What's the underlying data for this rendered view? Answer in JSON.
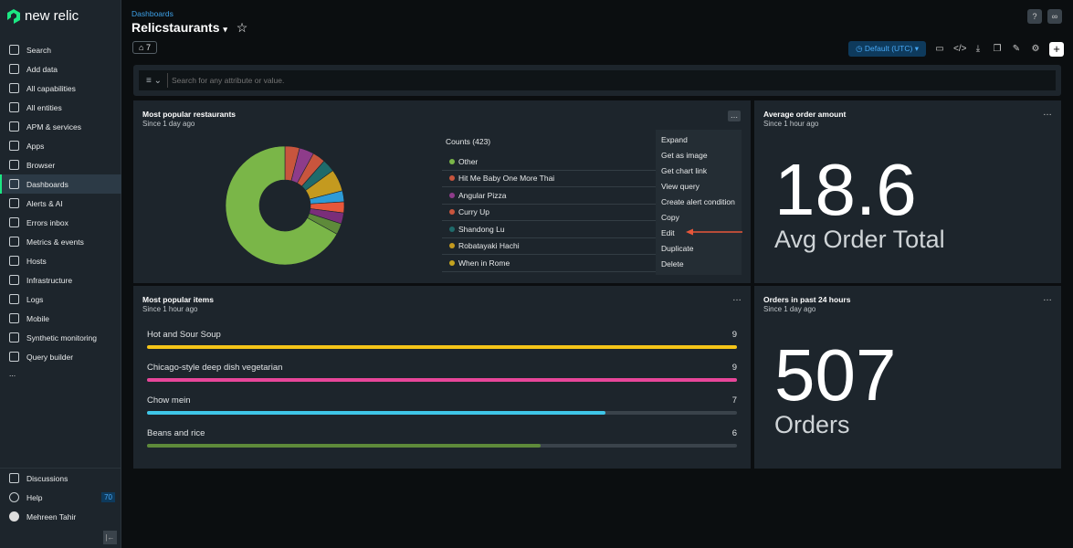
{
  "brand": {
    "name": "new relic"
  },
  "sidebar": {
    "items": [
      {
        "label": "Search",
        "icon": "search-icon"
      },
      {
        "label": "Add data",
        "icon": "plus-icon"
      },
      {
        "label": "All capabilities",
        "icon": "grid-icon"
      },
      {
        "label": "All entities",
        "icon": "entities-icon"
      },
      {
        "label": "APM & services",
        "icon": "globe-icon"
      },
      {
        "label": "Apps",
        "icon": "layers-icon"
      },
      {
        "label": "Browser",
        "icon": "browser-icon"
      },
      {
        "label": "Dashboards",
        "icon": "dashboard-icon",
        "active": true
      },
      {
        "label": "Alerts & AI",
        "icon": "alert-icon"
      },
      {
        "label": "Errors inbox",
        "icon": "inbox-icon"
      },
      {
        "label": "Metrics & events",
        "icon": "chart-icon"
      },
      {
        "label": "Hosts",
        "icon": "server-icon"
      },
      {
        "label": "Infrastructure",
        "icon": "infrastructure-icon"
      },
      {
        "label": "Logs",
        "icon": "logs-icon"
      },
      {
        "label": "Mobile",
        "icon": "mobile-icon"
      },
      {
        "label": "Synthetic monitoring",
        "icon": "synthetic-icon"
      },
      {
        "label": "Query builder",
        "icon": "query-icon"
      }
    ],
    "more": "...",
    "bottom": {
      "discussions": "Discussions",
      "help": "Help",
      "help_badge": "70",
      "user": "Mehreen Tahir"
    }
  },
  "header": {
    "breadcrumb": "Dashboards",
    "title": "Relicstaurants",
    "tag_count": "7",
    "timezone": "Default (UTC)"
  },
  "filter": {
    "placeholder": "Search for any attribute or value."
  },
  "widgets": {
    "restaurants": {
      "title": "Most popular restaurants",
      "since": "Since 1 day ago",
      "legend_title": "Counts (423)",
      "menu": [
        "Expand",
        "Get as image",
        "Get chart link",
        "View query",
        "Create alert condition",
        "Copy",
        "Edit",
        "Duplicate",
        "Delete"
      ]
    },
    "avg": {
      "title": "Average order amount",
      "since": "Since 1 hour ago",
      "value": "18.6",
      "label": "Avg Order Total"
    },
    "items": {
      "title": "Most popular items",
      "since": "Since 1 hour ago"
    },
    "orders": {
      "title": "Orders in past 24 hours",
      "since": "Since 1 day ago",
      "value": "507",
      "label": "Orders"
    }
  },
  "chart_data": [
    {
      "type": "pie",
      "donut": true,
      "title": "Most popular restaurants",
      "legend_title": "Counts (423)",
      "slices": [
        {
          "name": "Hit Me Baby One More Thai",
          "pct": 4,
          "color": "#c8553d"
        },
        {
          "name": "Angular Pizza",
          "pct": 4,
          "color": "#8e3c8a"
        },
        {
          "name": "Curry Up",
          "pct": 3.5,
          "color": "#c8553d"
        },
        {
          "name": "Shandong Lu",
          "pct": 3.5,
          "color": "#1f6b6b"
        },
        {
          "name": "Robatayaki Hachi",
          "pct": 6,
          "color": "#c49a1f"
        },
        {
          "name": "",
          "pct": 3,
          "color": "#2e9bd6"
        },
        {
          "name": "",
          "pct": 3,
          "color": "#e8573a"
        },
        {
          "name": "",
          "pct": 3,
          "color": "#7a2e7a"
        },
        {
          "name": "When in Rome",
          "pct": 3,
          "color": "#5e8a3a"
        },
        {
          "name": "Other",
          "pct": 67,
          "color": "#7ab648"
        }
      ],
      "legend": [
        {
          "name": "Other",
          "color": "#7ab648"
        },
        {
          "name": "Hit Me Baby One More Thai",
          "color": "#c8553d"
        },
        {
          "name": "Angular Pizza",
          "color": "#8e3c8a"
        },
        {
          "name": "Curry Up",
          "color": "#c8553d"
        },
        {
          "name": "Shandong Lu",
          "color": "#1f6b6b"
        },
        {
          "name": "Robatayaki Hachi",
          "color": "#c49a1f"
        },
        {
          "name": "When in Rome",
          "color": "#c4a41f"
        }
      ]
    },
    {
      "type": "bar",
      "orientation": "horizontal",
      "title": "Most popular items",
      "max": 9,
      "categories": [
        "Hot and Sour Soup",
        "Chicago-style deep dish vegetarian",
        "Chow mein",
        "Beans and rice"
      ],
      "values": [
        9,
        9,
        7,
        6
      ],
      "colors": [
        "#f5c518",
        "#e8469a",
        "#3fc6e8",
        "#5e8a3a"
      ]
    }
  ]
}
